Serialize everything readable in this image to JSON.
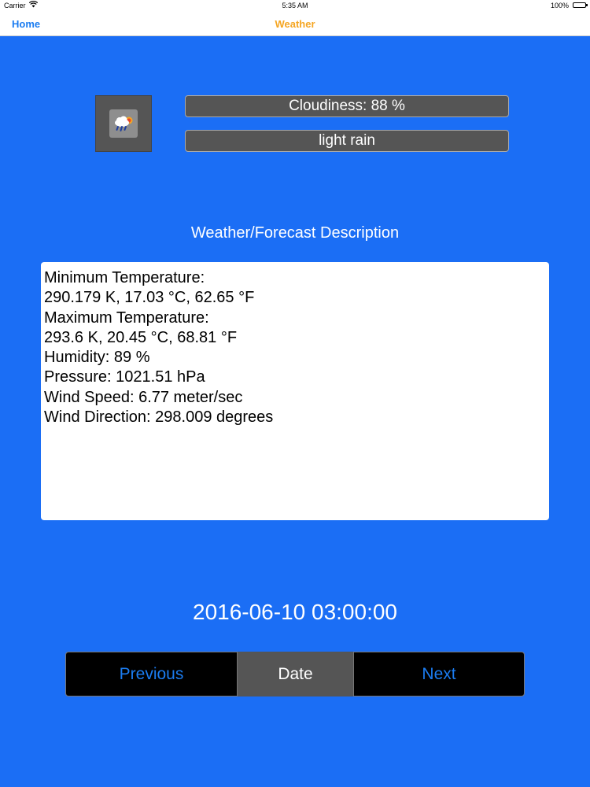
{
  "status_bar": {
    "carrier": "Carrier",
    "time": "5:35 AM",
    "battery": "100%"
  },
  "nav": {
    "back_label": "Home",
    "title": "Weather"
  },
  "summary": {
    "icon": "cloud-rain-sun-icon",
    "cloudiness": "Cloudiness: 88 %",
    "description": "light rain"
  },
  "details": {
    "heading": "Weather/Forecast Description",
    "lines": [
      "Minimum Temperature:",
      "290.179 K, 17.03 °C, 62.65 °F",
      "Maximum Temperature:",
      "293.6 K, 20.45 °C, 68.81 °F",
      "Humidity: 89 %",
      "Pressure: 1021.51 hPa",
      "Wind Speed: 6.77 meter/sec",
      "Wind Direction: 298.009 degrees"
    ]
  },
  "forecast_date": "2016-06-10 03:00:00",
  "controls": {
    "previous_label": "Previous",
    "date_label": "Date",
    "next_label": "Next"
  },
  "colors": {
    "background": "#1B6EF5",
    "accent": "#1B7CF0",
    "title": "#F5A623",
    "panel": "#555555"
  }
}
